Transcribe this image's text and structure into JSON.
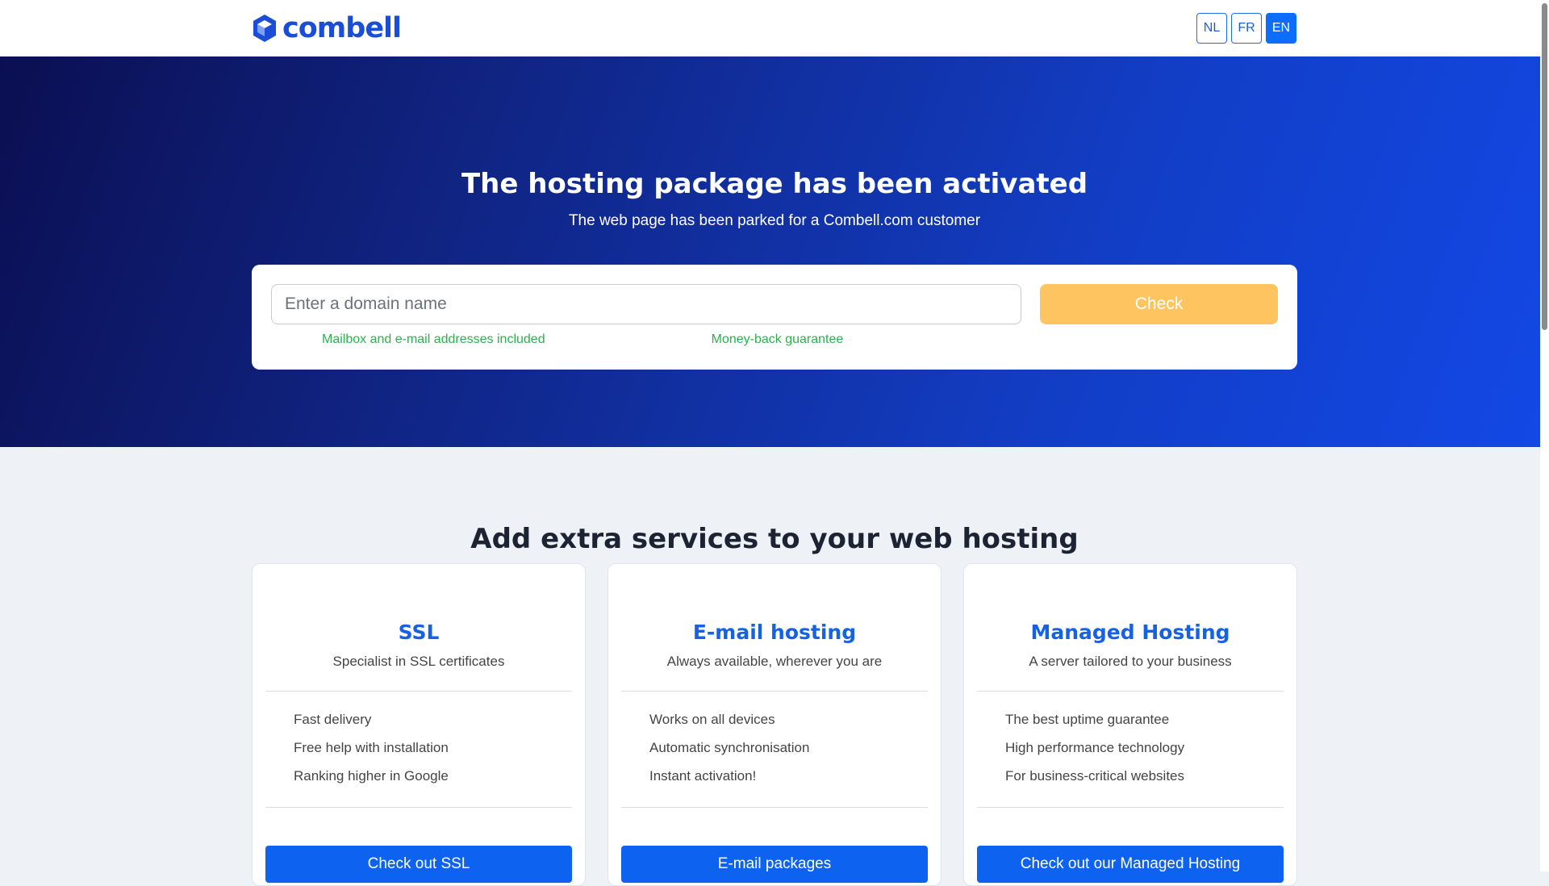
{
  "header": {
    "logo_text": "combell",
    "brand_color": "#1a4ed6",
    "languages": [
      {
        "label": "NL",
        "active": false
      },
      {
        "label": "FR",
        "active": false
      },
      {
        "label": "EN",
        "active": true
      }
    ]
  },
  "hero": {
    "title": "The hosting package has been activated",
    "subtitle": "The web page has been parked for a Combell.com customer",
    "search": {
      "placeholder": "Enter a domain name",
      "value": "",
      "button_label": "Check"
    },
    "features": [
      "Mailbox and e-mail addresses included",
      "Money-back guarantee"
    ]
  },
  "services": {
    "title": "Add extra services to your web hosting",
    "cards": [
      {
        "title": "SSL",
        "tagline": "Specialist in SSL certificates",
        "items": [
          "Fast delivery",
          "Free help with installation",
          "Ranking higher in Google"
        ],
        "cta": "Check out SSL"
      },
      {
        "title": "E-mail hosting",
        "tagline": "Always available, wherever you are",
        "items": [
          "Works on all devices",
          "Automatic synchronisation",
          "Instant activation!"
        ],
        "cta": "E-mail packages"
      },
      {
        "title": "Managed Hosting",
        "tagline": "A server tailored to your business",
        "items": [
          "The best uptime guarantee",
          "High performance technology",
          "For business-critical websites"
        ],
        "cta": "Check out our Managed Hosting"
      }
    ]
  },
  "colors": {
    "accent": "#0d63f0",
    "check_button": "#fdc45f",
    "feature_text": "#2bb14c"
  }
}
